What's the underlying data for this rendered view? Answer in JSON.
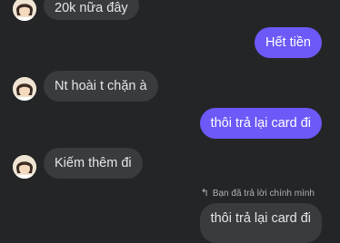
{
  "conversation": {
    "messages": [
      {
        "direction": "incoming",
        "text": "20k nữa đây"
      },
      {
        "direction": "outgoing",
        "text": "Hết tiền"
      },
      {
        "direction": "incoming",
        "text": "Nt hoài t chặn à"
      },
      {
        "direction": "outgoing",
        "text": "thôi trả lại card đi"
      },
      {
        "direction": "incoming",
        "text": "Kiếm thêm đi"
      },
      {
        "direction": "outgoing",
        "text": "thôi trả lại card đi",
        "reply_note": "Bạn đã trả lời chính mình"
      }
    ]
  },
  "icons": {
    "reply": "reply-arrow-icon",
    "avatar": "contact-avatar"
  },
  "colors": {
    "background": "#242526",
    "incoming_bubble": "#3a3b3c",
    "outgoing_bubble": "#6c59f7",
    "incoming_text": "#e4e6eb",
    "outgoing_text": "#ffffff",
    "meta_text": "#b0b3b8"
  }
}
